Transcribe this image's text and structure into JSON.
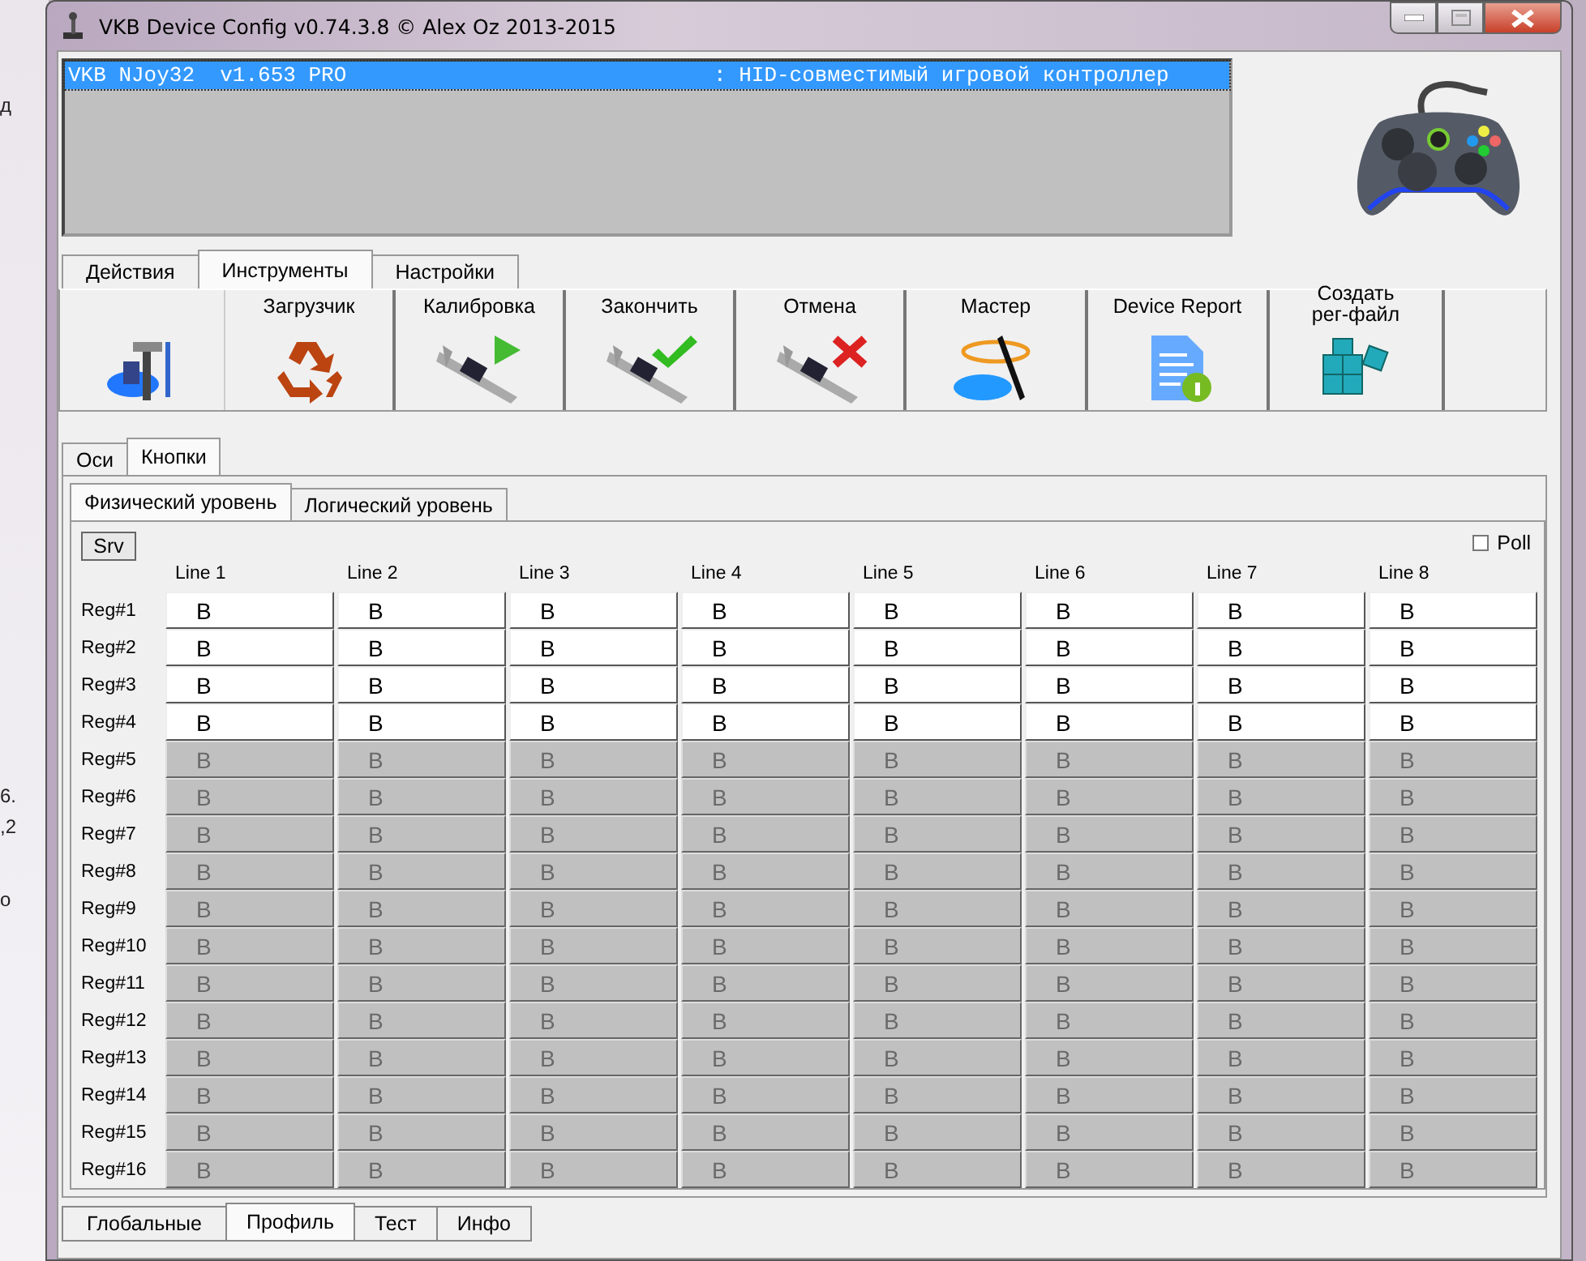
{
  "background_window": {
    "texts": [
      "д",
      "6.",
      ",2",
      "о"
    ]
  },
  "window": {
    "title": "VKB Device Config v0.74.3.8 © Alex Oz 2013-2015"
  },
  "devices": [
    {
      "name": "VKB NJoy32  v1.653 PRO",
      "description": ": HID-совместимый игровой контроллер",
      "selected": true
    }
  ],
  "top_tabs": [
    {
      "label": "Действия",
      "selected": false
    },
    {
      "label": "Инструменты",
      "selected": true
    },
    {
      "label": "Настройки",
      "selected": false
    }
  ],
  "toolbar": [
    {
      "kind": "tools"
    },
    {
      "kind": "recycle",
      "label": "Загрузчик"
    },
    {
      "kind": "caliper-play",
      "label": "Калибровка"
    },
    {
      "kind": "caliper-check",
      "label": "Закончить"
    },
    {
      "kind": "caliper-cross",
      "label": "Отмена"
    },
    {
      "kind": "wand",
      "label": "Мастер"
    },
    {
      "kind": "report",
      "label": "Device Report"
    },
    {
      "kind": "cubes",
      "label": "Создать\nрег-файл"
    }
  ],
  "mode_tabs": [
    {
      "label": "Оси",
      "selected": false
    },
    {
      "label": "Кнопки",
      "selected": true
    }
  ],
  "level_tabs": [
    {
      "label": "Физический уровень",
      "selected": true
    },
    {
      "label": "Логический уровень",
      "selected": false
    }
  ],
  "srv_button": "Srv",
  "poll": {
    "label": "Poll",
    "checked": false
  },
  "table": {
    "columns": [
      "Line 1",
      "Line 2",
      "Line 3",
      "Line 4",
      "Line 5",
      "Line 6",
      "Line 7",
      "Line 8"
    ],
    "rows": [
      {
        "label": "Reg#1",
        "enabled": true,
        "cells": [
          "B",
          "B",
          "B",
          "B",
          "B",
          "B",
          "B",
          "B"
        ]
      },
      {
        "label": "Reg#2",
        "enabled": true,
        "cells": [
          "B",
          "B",
          "B",
          "B",
          "B",
          "B",
          "B",
          "B"
        ]
      },
      {
        "label": "Reg#3",
        "enabled": true,
        "cells": [
          "B",
          "B",
          "B",
          "B",
          "B",
          "B",
          "B",
          "B"
        ]
      },
      {
        "label": "Reg#4",
        "enabled": true,
        "cells": [
          "B",
          "B",
          "B",
          "B",
          "B",
          "B",
          "B",
          "B"
        ]
      },
      {
        "label": "Reg#5",
        "enabled": false,
        "cells": [
          "B",
          "B",
          "B",
          "B",
          "B",
          "B",
          "B",
          "B"
        ]
      },
      {
        "label": "Reg#6",
        "enabled": false,
        "cells": [
          "B",
          "B",
          "B",
          "B",
          "B",
          "B",
          "B",
          "B"
        ]
      },
      {
        "label": "Reg#7",
        "enabled": false,
        "cells": [
          "B",
          "B",
          "B",
          "B",
          "B",
          "B",
          "B",
          "B"
        ]
      },
      {
        "label": "Reg#8",
        "enabled": false,
        "cells": [
          "B",
          "B",
          "B",
          "B",
          "B",
          "B",
          "B",
          "B"
        ]
      },
      {
        "label": "Reg#9",
        "enabled": false,
        "cells": [
          "B",
          "B",
          "B",
          "B",
          "B",
          "B",
          "B",
          "B"
        ]
      },
      {
        "label": "Reg#10",
        "enabled": false,
        "cells": [
          "B",
          "B",
          "B",
          "B",
          "B",
          "B",
          "B",
          "B"
        ]
      },
      {
        "label": "Reg#11",
        "enabled": false,
        "cells": [
          "B",
          "B",
          "B",
          "B",
          "B",
          "B",
          "B",
          "B"
        ]
      },
      {
        "label": "Reg#12",
        "enabled": false,
        "cells": [
          "B",
          "B",
          "B",
          "B",
          "B",
          "B",
          "B",
          "B"
        ]
      },
      {
        "label": "Reg#13",
        "enabled": false,
        "cells": [
          "B",
          "B",
          "B",
          "B",
          "B",
          "B",
          "B",
          "B"
        ]
      },
      {
        "label": "Reg#14",
        "enabled": false,
        "cells": [
          "B",
          "B",
          "B",
          "B",
          "B",
          "B",
          "B",
          "B"
        ]
      },
      {
        "label": "Reg#15",
        "enabled": false,
        "cells": [
          "B",
          "B",
          "B",
          "B",
          "B",
          "B",
          "B",
          "B"
        ]
      },
      {
        "label": "Reg#16",
        "enabled": false,
        "cells": [
          "B",
          "B",
          "B",
          "B",
          "B",
          "B",
          "B",
          "B"
        ]
      }
    ]
  },
  "bottom_tabs": [
    {
      "label": "Глобальные",
      "selected": false
    },
    {
      "label": "Профиль",
      "selected": true
    },
    {
      "label": "Тест",
      "selected": false
    },
    {
      "label": "Инфо",
      "selected": false
    }
  ]
}
